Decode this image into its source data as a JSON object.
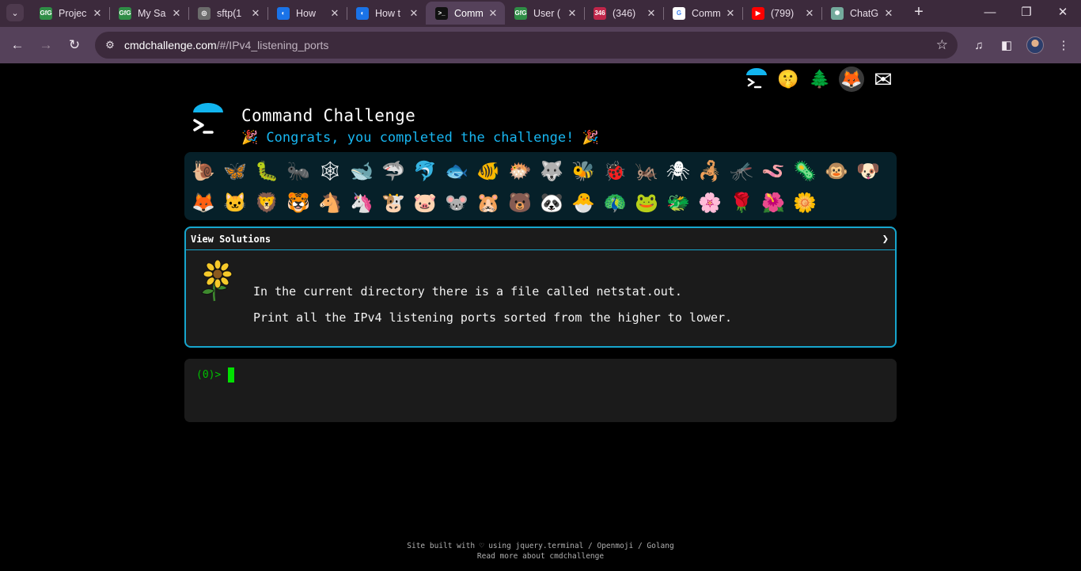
{
  "browser": {
    "tab_dropdown_icon": "chevron-down-icon",
    "tabs": [
      {
        "title": "Projec",
        "favicon": "GfG",
        "favicon_color": "#2f8d46",
        "active": false
      },
      {
        "title": "My Sa",
        "favicon": "GfG",
        "favicon_color": "#2f8d46",
        "active": false
      },
      {
        "title": "sftp(1",
        "favicon": "◎",
        "favicon_color": "#6b6b6b",
        "active": false
      },
      {
        "title": "How",
        "favicon": "◐",
        "favicon_color": "#1a73e8",
        "active": false
      },
      {
        "title": "How t",
        "favicon": "◐",
        "favicon_color": "#1a73e8",
        "active": false
      },
      {
        "title": "Comm",
        "favicon": ">_",
        "favicon_color": "#111111",
        "active": true
      },
      {
        "title": "User (",
        "favicon": "GfG",
        "favicon_color": "#2f8d46",
        "active": false
      },
      {
        "title": "(346)",
        "favicon": "346",
        "favicon_color": "#c0264a",
        "active": false
      },
      {
        "title": "Comm",
        "favicon": "G",
        "favicon_color": "#ffffff",
        "active": false
      },
      {
        "title": "(799)",
        "favicon": "▶",
        "favicon_color": "#ff0000",
        "active": false
      },
      {
        "title": "ChatG",
        "favicon": "✺",
        "favicon_color": "#74aa9c",
        "active": false
      }
    ],
    "new_tab_label": "+",
    "url_host": "cmdchallenge.com",
    "url_path": "/#/IPv4_listening_ports",
    "window_controls": {
      "minimize": "—",
      "restore": "❐",
      "close": "✕"
    }
  },
  "top_icons": [
    "🤫",
    "🌲",
    "🦊",
    "✉"
  ],
  "header": {
    "title": "Command Challenge",
    "congrats": "🎉 Congrats, you completed the challenge! 🎉"
  },
  "achievements": {
    "row1": [
      "🐌",
      "🦋",
      "🐛",
      "🐜",
      "🕸",
      "🐋",
      "🦈",
      "🐬",
      "🐟",
      "🐠",
      "🐡",
      "🐺",
      "🐝",
      "🐞",
      "🦗",
      "🕷",
      "🦂",
      "🦟",
      "🪱",
      "🦠",
      "🐵",
      "🐶"
    ],
    "row2": [
      "🦊",
      "🐱",
      "🦁",
      "🐯",
      "🐴",
      "🦄",
      "🐮",
      "🐷",
      "🐭",
      "🐹",
      "🐻",
      "🐼",
      "🐣",
      "🦚",
      "🐸",
      "🐲",
      "🌸",
      "🌹",
      "🌺",
      "🌼"
    ]
  },
  "challenge": {
    "header_label": "View Solutions",
    "expand_icon": "chevron-right-icon",
    "line1": "In the current directory there is a file called netstat.out.",
    "line2": "Print all the IPv4 listening ports sorted from the higher to lower."
  },
  "terminal": {
    "prompt": "(0)>"
  },
  "footer": {
    "line1": "Site built with ♡ using jquery.terminal / Openmoji / Golang",
    "line2": "Read more about cmdchallenge"
  }
}
